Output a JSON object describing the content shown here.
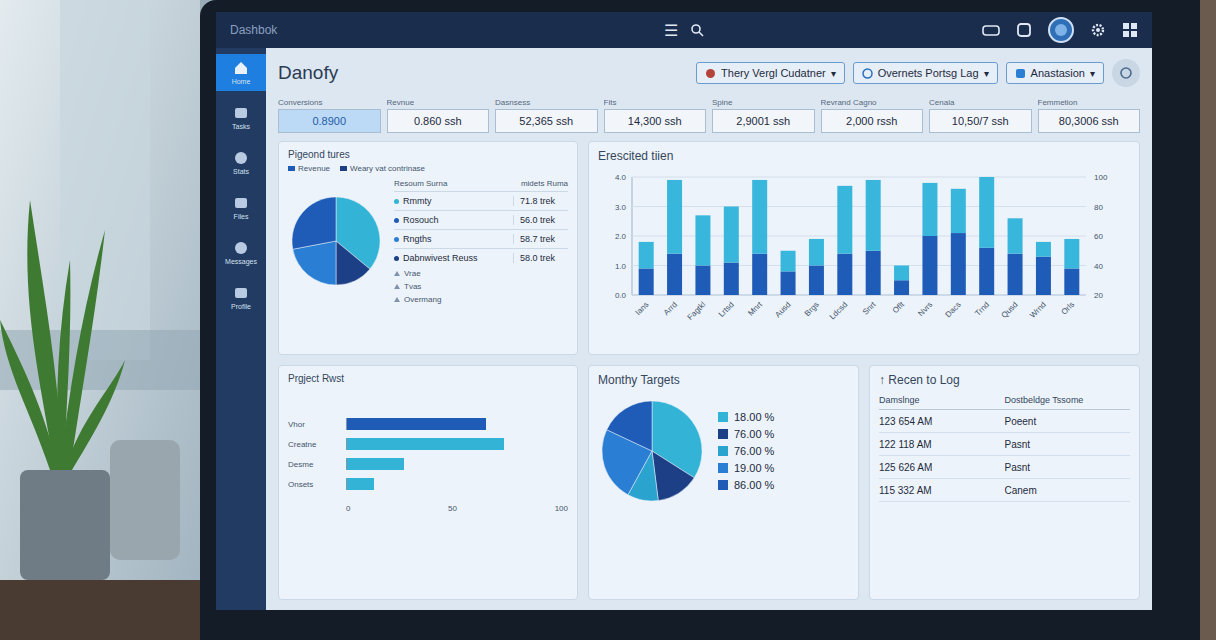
{
  "topbar": {
    "brand": "Dashbok",
    "menu_icon": "☰"
  },
  "sidebar": {
    "items": [
      {
        "label": "Home",
        "selected": true
      },
      {
        "label": "Tasks",
        "selected": false
      },
      {
        "label": "Stats",
        "selected": false
      },
      {
        "label": "Files",
        "selected": false
      },
      {
        "label": "Messages",
        "selected": false
      },
      {
        "label": "Profile",
        "selected": false
      }
    ]
  },
  "header": {
    "title": "Danofy",
    "caret": "▾",
    "dropdowns": [
      "Thery Vergl Cudatner",
      "Overnets Portsg Lag",
      "Anastasion"
    ]
  },
  "stats": [
    {
      "label": "Conversions",
      "value": "0.8900",
      "selected": true
    },
    {
      "label": "Revnue",
      "value": "0.860 ssh",
      "selected": false
    },
    {
      "label": "Dasnsess",
      "value": "52,365 ssh",
      "selected": false
    },
    {
      "label": "Fits",
      "value": "14,300 ssh",
      "selected": false
    },
    {
      "label": "Spine",
      "value": "2,9001 ssh",
      "selected": false
    },
    {
      "label": "Revrand Cagno",
      "value": "2,000 rssh",
      "selected": false
    },
    {
      "label": "Cenala",
      "value": "10,50/7 ssh",
      "selected": false
    },
    {
      "label": "Femmetion",
      "value": "80,3006 ssh",
      "selected": false
    }
  ],
  "pie_card": {
    "title": "Pigeond tures",
    "legend": [
      {
        "label": "Revenue",
        "color": "#1f5cb8"
      },
      {
        "label": "Weary vat contrinase",
        "color": "#1c3f85"
      }
    ],
    "slices": [
      {
        "value": 36,
        "color": "#33b3d6"
      },
      {
        "value": 14,
        "color": "#1c3f85"
      },
      {
        "value": 22,
        "color": "#2a7fd4"
      },
      {
        "value": 28,
        "color": "#1f5cb8"
      }
    ],
    "columns": [
      "Resoum Surna",
      "midets Ruma"
    ],
    "rows": [
      {
        "label": "Rmmty",
        "value": "71.8 trek",
        "color": "#33b3d6"
      },
      {
        "label": "Rosouch",
        "value": "56.0 trek",
        "color": "#1f5cb8"
      },
      {
        "label": "Rngths",
        "value": "58.7 trek",
        "color": "#2a7fd4"
      },
      {
        "label": "Dabnwivest Reuss",
        "value": "58.0 trek",
        "color": "#1c3f85"
      }
    ],
    "extra_rows": [
      "Vrae",
      "Tvas",
      "Overmang"
    ]
  },
  "bar_chart": {
    "title": "Erescited tiien",
    "y_ticks": [
      "4.0",
      "3.0",
      "2.0",
      "1.0",
      "0.0"
    ],
    "y2_ticks": [
      "100",
      "80",
      "60",
      "40",
      "20"
    ],
    "x_labels": [
      "Ians",
      "Arrd",
      "Fagtkl",
      "Lrtsd",
      "Mnrt",
      "Ausd",
      "Brgs",
      "Ldcsd",
      "Snrt",
      "Oflt",
      "Nvrs",
      "Dacs",
      "Trnd",
      "Qusd",
      "Wrnd",
      "Orls"
    ],
    "series": [
      {
        "color": "#1f5cb8",
        "values": [
          0.9,
          1.4,
          1.0,
          1.1,
          1.4,
          0.8,
          1.0,
          1.4,
          1.5,
          0.5,
          2.0,
          2.1,
          1.6,
          1.4,
          1.3,
          0.9
        ]
      },
      {
        "color": "#38b6dc",
        "values": [
          0.9,
          2.5,
          1.7,
          1.9,
          2.5,
          0.7,
          0.9,
          2.3,
          2.4,
          0.5,
          1.8,
          1.5,
          2.4,
          1.2,
          0.5,
          1.0
        ]
      }
    ]
  },
  "project_card": {
    "title": "Prgject Rwst",
    "axis": [
      "0",
      "50",
      "100"
    ],
    "bars": [
      {
        "label": "Vhor",
        "value": 63,
        "color": "#1f5cb8"
      },
      {
        "label": "Creatne",
        "value": 71,
        "color": "#33b3d6"
      },
      {
        "label": "Desme",
        "value": 26,
        "color": "#33b3d6"
      },
      {
        "label": "Onsets",
        "value": 12,
        "color": "#33b3d6"
      }
    ]
  },
  "targets": {
    "title": "Monthy Targets",
    "slices": [
      {
        "label": "18.00 %",
        "value": 34,
        "color": "#33b3d6"
      },
      {
        "label": "76.00 %",
        "value": 14,
        "color": "#1c3f85"
      },
      {
        "label": "76.00 %",
        "value": 10,
        "color": "#2aa3cf"
      },
      {
        "label": "19.00 %",
        "value": 24,
        "color": "#2a7fd4"
      },
      {
        "label": "86.00 %",
        "value": 18,
        "color": "#1f5cb8"
      }
    ]
  },
  "log": {
    "title": "Recen to Log",
    "icon": "↑",
    "columns": [
      "Damslnge",
      "Dostbeldge Tssome"
    ],
    "rows": [
      {
        "time": "123 654 AM",
        "status": "Poeent"
      },
      {
        "time": "122 118 AM",
        "status": "Pasnt"
      },
      {
        "time": "125 626 AM",
        "status": "Pasnt"
      },
      {
        "time": "115 332 AM",
        "status": "Canem"
      }
    ]
  }
}
